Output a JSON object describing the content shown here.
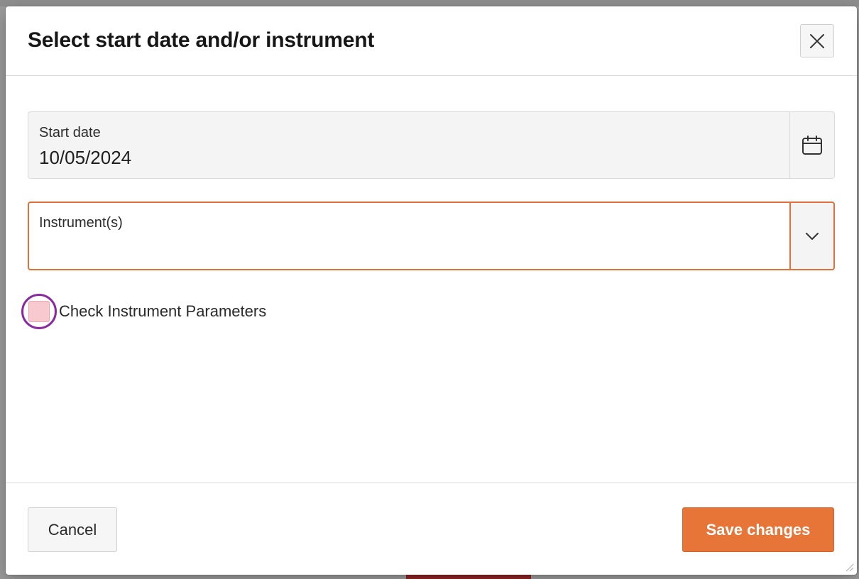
{
  "dialog": {
    "title": "Select start date and/or instrument",
    "close_icon": "close-icon"
  },
  "start_date": {
    "label": "Start date",
    "value": "10/05/2024",
    "icon": "calendar-icon"
  },
  "instrument": {
    "label": "Instrument(s)",
    "value": "",
    "icon": "chevron-down-icon",
    "accent_color": "#e0703a"
  },
  "check_parameters": {
    "label": "Check Instrument Parameters",
    "checked": false
  },
  "footer": {
    "cancel_label": "Cancel",
    "save_label": "Save changes",
    "save_color": "#e87538"
  }
}
